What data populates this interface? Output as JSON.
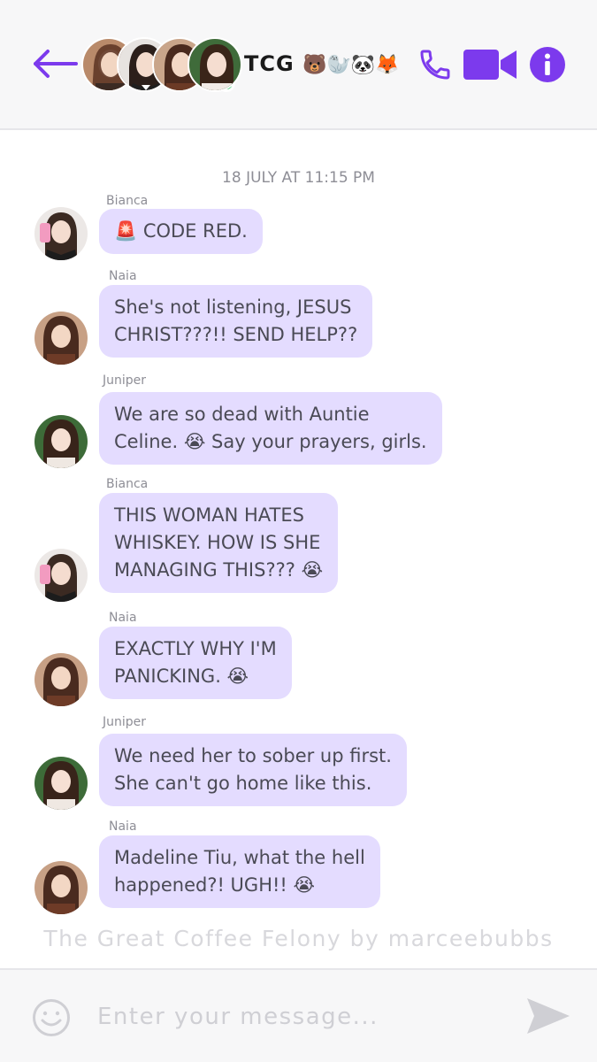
{
  "header": {
    "title": "TCG",
    "title_emojis": "🐻🦭🐼🦊",
    "accent_color": "#7c3aed",
    "online_color": "#22c55e",
    "icons": [
      "back-arrow-icon",
      "phone-icon",
      "video-camera-icon",
      "info-icon"
    ]
  },
  "conversation": {
    "timestamp": "18 JULY AT 11:15 PM",
    "bubble_color": "#e4dcff",
    "messages": [
      {
        "sender": "Bianca",
        "text": "🚨 CODE RED."
      },
      {
        "sender": "Naia",
        "text": "She's not listening, JESUS\nCHRIST???!! SEND HELP??"
      },
      {
        "sender": "Juniper",
        "text": "We are so dead with Auntie\nCeline. 😭 Say your prayers, girls."
      },
      {
        "sender": "Bianca",
        "text": "THIS WOMAN HATES\nWHISKEY. HOW IS SHE\nMANAGING THIS??? 😭"
      },
      {
        "sender": "Naia",
        "text": "EXACTLY WHY I'M\nPANICKING. 😭"
      },
      {
        "sender": "Juniper",
        "text": "We need her to sober up first.\nShe can't go home like this."
      },
      {
        "sender": "Naia",
        "text": "Madeline Tiu, what the hell\nhappened?! UGH!! 😭"
      }
    ]
  },
  "credit": "The Great Coffee Felony by marceebubbs",
  "composer": {
    "placeholder": "Enter your message...",
    "value": "",
    "icons": [
      "smiley-icon",
      "send-icon"
    ]
  }
}
